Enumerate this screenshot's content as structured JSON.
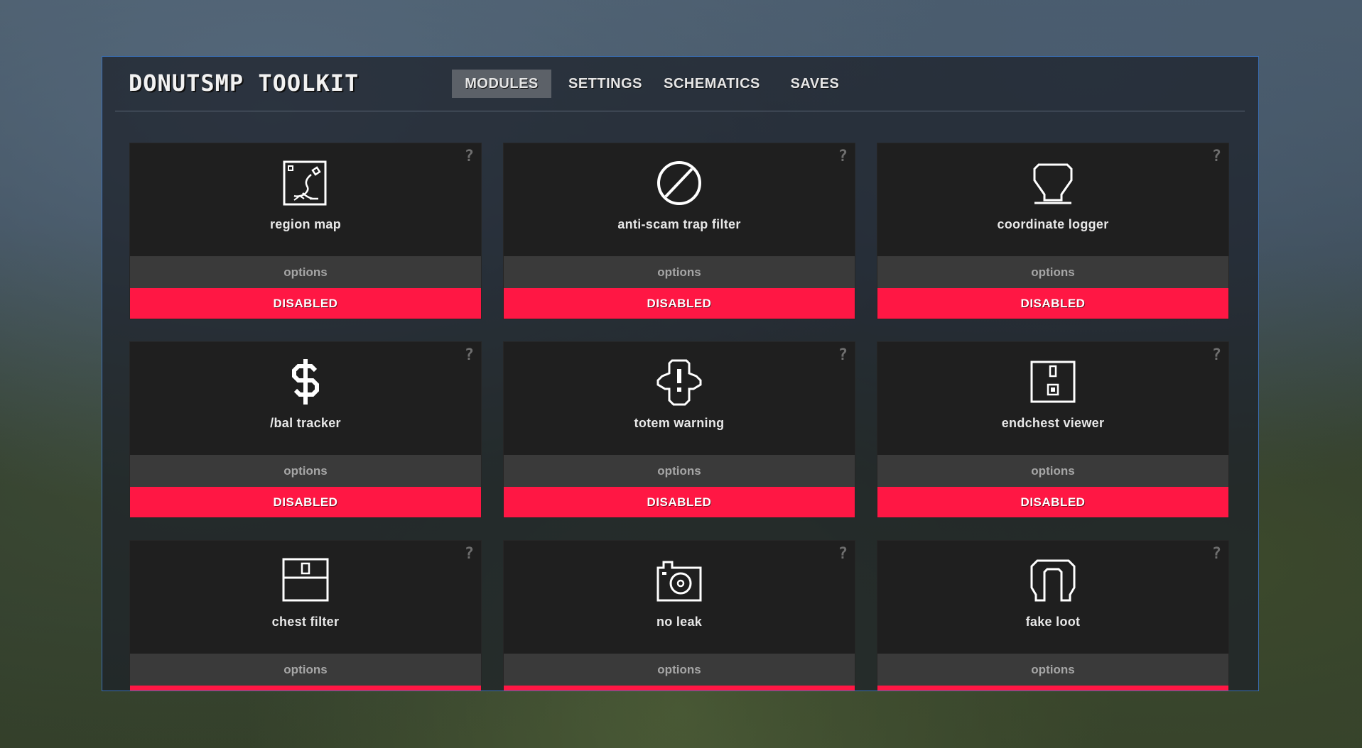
{
  "app": {
    "title": "DONUTSMP TOOLKIT"
  },
  "tabs": [
    {
      "label": "MODULES",
      "active": true
    },
    {
      "label": "SETTINGS",
      "active": false
    },
    {
      "label": "SCHEMATICS",
      "active": false
    },
    {
      "label": "SAVES",
      "active": false
    }
  ],
  "colors": {
    "disabled": "#ff1744",
    "options_bg": "#3a3a3a",
    "card_bg": "#1f1f1f",
    "active_tab": "#5c6168"
  },
  "modules": [
    {
      "name": "region map",
      "icon": "map-icon",
      "help": "?",
      "options_label": "options",
      "status": "DISABLED"
    },
    {
      "name": "anti-scam trap filter",
      "icon": "no-entry-icon",
      "help": "?",
      "options_label": "options",
      "status": "DISABLED"
    },
    {
      "name": "coordinate logger",
      "icon": "location-pin-icon",
      "help": "?",
      "options_label": "options",
      "status": "DISABLED"
    },
    {
      "name": "/bal tracker",
      "icon": "dollar-icon",
      "help": "?",
      "options_label": "options",
      "status": "DISABLED"
    },
    {
      "name": "totem warning",
      "icon": "totem-warning-icon",
      "help": "?",
      "options_label": "options",
      "status": "DISABLED"
    },
    {
      "name": "endchest viewer",
      "icon": "endchest-icon",
      "help": "?",
      "options_label": "options",
      "status": "DISABLED"
    },
    {
      "name": "chest filter",
      "icon": "chest-icon",
      "help": "?",
      "options_label": "options",
      "status": ""
    },
    {
      "name": "no leak",
      "icon": "camera-icon",
      "help": "?",
      "options_label": "options",
      "status": ""
    },
    {
      "name": "fake loot",
      "icon": "pants-icon",
      "help": "?",
      "options_label": "options",
      "status": ""
    }
  ]
}
